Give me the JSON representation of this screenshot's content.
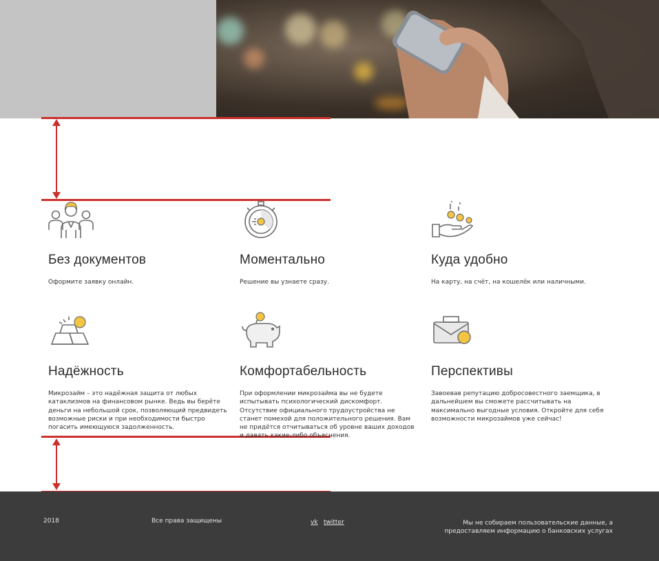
{
  "features": [
    {
      "icon": "people-icon",
      "title": "Без документов",
      "text": "Оформите заявку онлайн."
    },
    {
      "icon": "stopwatch-icon",
      "title": "Моментально",
      "text": "Решение вы узнаете сразу."
    },
    {
      "icon": "hand-coins-icon",
      "title": "Куда удобно",
      "text": "На карту, на счёт, на кошелёк или наличными."
    },
    {
      "icon": "gold-bars-icon",
      "title": "Надёжность",
      "text": "Микрозайм – это надёжная защита от любых катаклизмов на финансовом рынке. Ведь вы берёте деньги на небольшой срок, позволяющий предвидеть возможные риски и при необходимости быстро погасить имеющуюся задолженность."
    },
    {
      "icon": "piggy-bank-icon",
      "title": "Комфортабельность",
      "text": "При оформлении микрозайма вы не будете испытывать психологический дискомфорт. Отсутствие официального трудоустройства не станет помехой для положительного решения. Вам не придётся отчитываться об  уровне ваших доходов и давать какие-либо объяснения."
    },
    {
      "icon": "briefcase-coin-icon",
      "title": "Перспективы",
      "text": "Завоевав репутацию добросовестного заемщика, в дальнейшем вы сможете рассчитывать на максимально выгодные условия. Откройте для себя возможности микрозаймов уже сейчас!"
    }
  ],
  "footer": {
    "year": "2018",
    "rights": "Все права защищены",
    "links": [
      "vk",
      "twitter"
    ],
    "notice_line1": "Мы не собираем пользовательские данные, а",
    "notice_line2": "предоставляем информацию о банковских услугах"
  },
  "colors": {
    "accent": "#f5c542",
    "guide": "#c9302c",
    "footer_bg": "#3c3c3c",
    "icon_stroke": "#6d6d6d"
  }
}
